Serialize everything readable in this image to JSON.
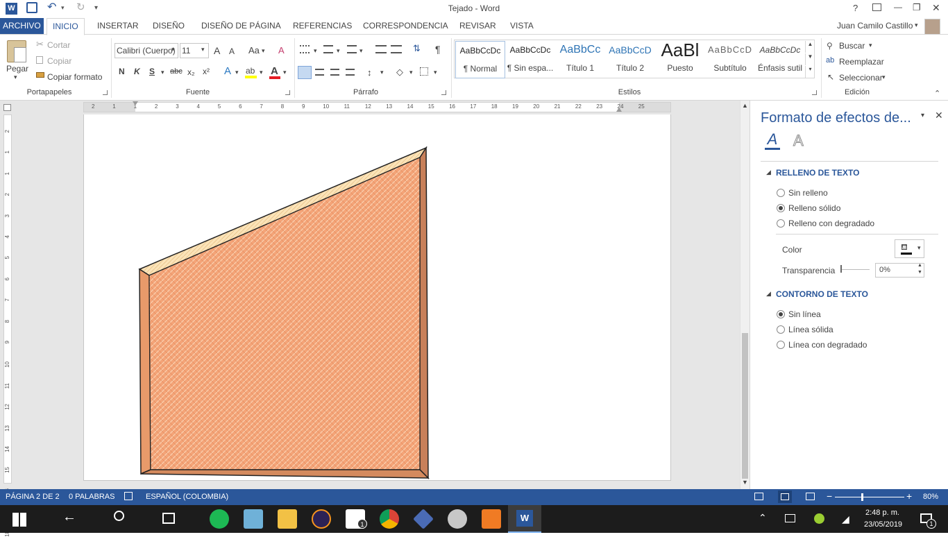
{
  "window": {
    "title": "Tejado - Word",
    "help": "?",
    "minimize": "—",
    "restore": "❐",
    "close": "✕"
  },
  "quick_access": {
    "undo": "↶",
    "redo": "↻",
    "more": "▾"
  },
  "tabs": [
    "ARCHIVO",
    "INICIO",
    "INSERTAR",
    "DISEÑO",
    "DISEÑO DE PÁGINA",
    "REFERENCIAS",
    "CORRESPONDENCIA",
    "REVISAR",
    "VISTA"
  ],
  "user": {
    "name": "Juan Camilo Castillo"
  },
  "clipboard": {
    "paste": "Pegar",
    "cut": "Cortar",
    "copy": "Copiar",
    "format_painter": "Copiar formato",
    "group": "Portapapeles"
  },
  "font": {
    "family": "Calibri (Cuerpo)",
    "size": "11",
    "group": "Fuente",
    "bold": "N",
    "italic": "K",
    "underline": "S",
    "strike": "abc",
    "sub": "x₂",
    "sup": "x²",
    "grow": "A",
    "shrink": "A",
    "case": "Aa",
    "clear": "A",
    "effects": "A",
    "highlight": "ab",
    "color": "A"
  },
  "paragraph": {
    "group": "Párrafo",
    "pilcrow": "¶"
  },
  "styles": {
    "group": "Estilos",
    "items": [
      {
        "preview": "AaBbCcDc",
        "name": "¶ Normal"
      },
      {
        "preview": "AaBbCcDc",
        "name": "¶ Sin espa..."
      },
      {
        "preview": "AaBbCc",
        "name": "Título 1"
      },
      {
        "preview": "AaBbCcD",
        "name": "Título 2"
      },
      {
        "preview": "AaBl",
        "name": "Puesto"
      },
      {
        "preview": "AaBbCcD",
        "name": "Subtítulo"
      },
      {
        "preview": "AaBbCcDc",
        "name": "Énfasis sutil"
      }
    ]
  },
  "editing": {
    "group": "Edición",
    "find": "Buscar",
    "replace": "Reemplazar",
    "select": "Seleccionar"
  },
  "ruler": {
    "h_ticks": [
      "2",
      "1",
      "1",
      "2",
      "3",
      "4",
      "5",
      "6",
      "7",
      "8",
      "9",
      "10",
      "11",
      "12",
      "13",
      "14",
      "15",
      "16",
      "17",
      "18",
      "19",
      "20",
      "21",
      "22",
      "23",
      "24",
      "25"
    ],
    "v_ticks": [
      "2",
      "1",
      "1",
      "2",
      "3",
      "4",
      "5",
      "6",
      "7",
      "8",
      "9",
      "10",
      "11",
      "12",
      "13",
      "14",
      "15",
      "16",
      "17",
      "18"
    ]
  },
  "pane": {
    "title": "Formato de efectos de...",
    "fill_header": "RELLENO DE TEXTO",
    "fill_options": [
      "Sin relleno",
      "Relleno sólido",
      "Relleno con degradado"
    ],
    "fill_selected": 1,
    "color_label": "Color",
    "transparency_label": "Transparencia",
    "transparency_value": "0%",
    "outline_header": "CONTORNO DE TEXTO",
    "outline_options": [
      "Sin línea",
      "Línea sólida",
      "Línea con degradado"
    ],
    "outline_selected": 0
  },
  "status": {
    "page": "PÁGINA 2 DE 2",
    "words": "0 PALABRAS",
    "language": "ESPAÑOL (COLOMBIA)",
    "zoom": "80%",
    "zoom_value": 80
  },
  "taskbar": {
    "time": "2:48 p. m.",
    "date": "23/05/2019",
    "mail_badge": "1",
    "notif_badge": "1"
  },
  "colors": {
    "accent": "#2b579a",
    "shape_fill": "#f4a478",
    "shape_edge": "#c8805a",
    "shape_top": "#fbe3b8",
    "highlight": "#ffff00",
    "font_color": "#e51c23"
  }
}
